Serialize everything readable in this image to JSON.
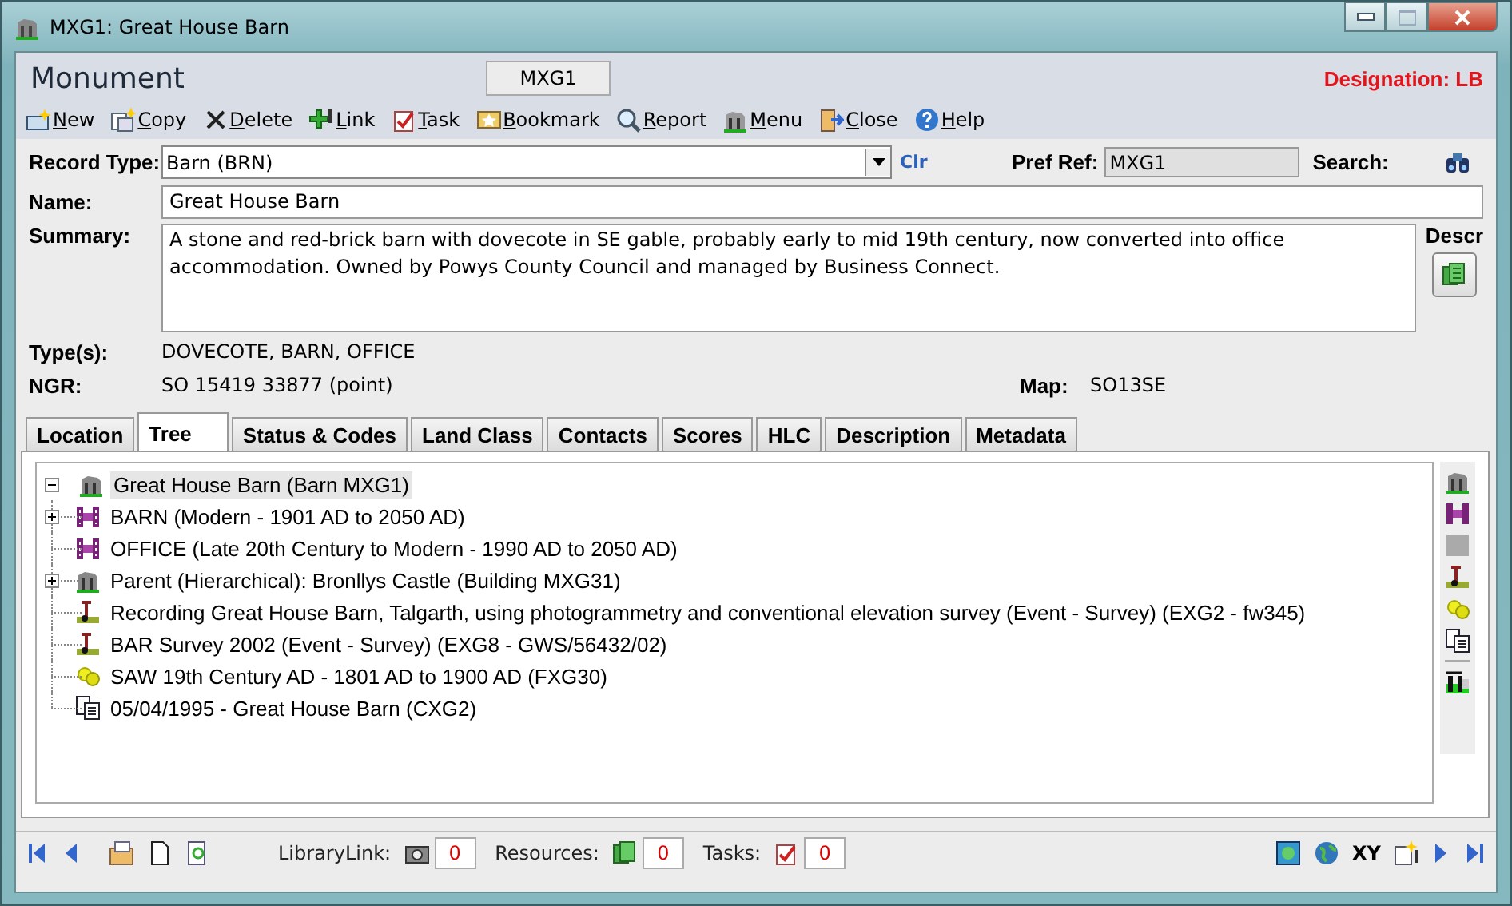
{
  "window": {
    "title": "MXG1: Great House Barn"
  },
  "header": {
    "title": "Monument",
    "ref": "MXG1",
    "designation": "Designation: LB"
  },
  "toolbar": [
    {
      "label": "New"
    },
    {
      "label": "Copy"
    },
    {
      "label": "Delete"
    },
    {
      "label": "Link"
    },
    {
      "label": "Task"
    },
    {
      "label": "Bookmark"
    },
    {
      "label": "Report"
    },
    {
      "label": "Menu"
    },
    {
      "label": "Close"
    },
    {
      "label": "Help"
    }
  ],
  "form": {
    "record_type": {
      "label": "Record Type:",
      "value": "Barn (BRN)",
      "clear": "Clr"
    },
    "pref_ref": {
      "label": "Pref Ref:",
      "value": "MXG1"
    },
    "search": {
      "label": "Search:"
    },
    "name": {
      "label": "Name:",
      "value": "Great House Barn"
    },
    "summary": {
      "label": "Summary:",
      "value": "A stone and red-brick barn with dovecote in SE gable, probably early to mid 19th century, now converted into office accommodation. Owned by Powys County Council and managed by Business Connect."
    },
    "descr": {
      "label": "Descr"
    },
    "types": {
      "label": "Type(s):",
      "value": "DOVECOTE, BARN, OFFICE"
    },
    "ngr": {
      "label": "NGR:",
      "value": "SO 15419 33877 (point)"
    },
    "map": {
      "label": "Map:",
      "value": "SO13SE"
    }
  },
  "tabs": [
    {
      "label": "Location",
      "selected": false
    },
    {
      "label": "Tree",
      "selected": true
    },
    {
      "label": "Status & Codes",
      "selected": false
    },
    {
      "label": "Land Class",
      "selected": false
    },
    {
      "label": "Contacts",
      "selected": false
    },
    {
      "label": "Scores",
      "selected": false
    },
    {
      "label": "HLC",
      "selected": false
    },
    {
      "label": "Description",
      "selected": false
    },
    {
      "label": "Metadata",
      "selected": false
    }
  ],
  "tree": {
    "items": [
      {
        "label": "Great House Barn (Barn MXG1)",
        "kind": "monument",
        "selected": true,
        "expanded": true,
        "children": [
          {
            "label": "BARN (Modern - 1901 AD to 2050 AD)",
            "kind": "component",
            "selected": false,
            "expanded": false,
            "expandable": true
          },
          {
            "label": "OFFICE (Late 20th Century to Modern - 1990 AD to 2050 AD)",
            "kind": "component",
            "selected": false
          },
          {
            "label": "Parent (Hierarchical): Bronllys Castle (Building MXG31)",
            "kind": "monument",
            "selected": false,
            "expanded": false,
            "expandable": true
          },
          {
            "label": "Recording Great House Barn, Talgarth, using photogrammetry and conventional elevation survey (Event - Survey) (EXG2 - fw345)",
            "kind": "event",
            "selected": false
          },
          {
            "label": "BAR Survey 2002 (Event - Survey) (EXG8 - GWS/56432/02)",
            "kind": "event",
            "selected": false
          },
          {
            "label": "SAW 19th Century AD - 1801 AD to 1900 AD (FXG30)",
            "kind": "find",
            "selected": false
          },
          {
            "label": "05/04/1995 - Great House Barn (CXG2)",
            "kind": "source",
            "selected": false
          }
        ]
      }
    ]
  },
  "status_bar": {
    "library_link": {
      "label": "LibraryLink:",
      "count": "0"
    },
    "resources": {
      "label": "Resources:",
      "count": "0"
    },
    "tasks": {
      "label": "Tasks:",
      "count": "0"
    },
    "xy": "XY"
  }
}
